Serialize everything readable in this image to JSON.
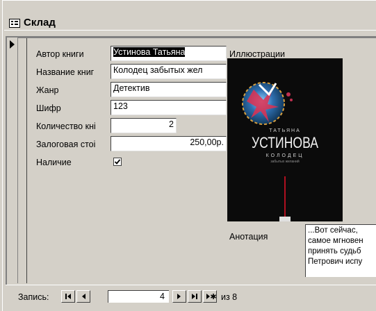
{
  "window": {
    "title": "Склад"
  },
  "fields": {
    "author": {
      "label": "Автор книги",
      "value": "Устинова Татьяна"
    },
    "title": {
      "label": "Название книг",
      "value": "Колодец забытых жел"
    },
    "genre": {
      "label": "Жанр",
      "value": "Детектив"
    },
    "code": {
      "label": "Шифр",
      "value": "123"
    },
    "quantity": {
      "label": "Количество кні",
      "value": "2"
    },
    "deposit": {
      "label": "Залоговая стоі",
      "value": "250,00р."
    },
    "availability": {
      "label": "Наличие",
      "checked": true
    }
  },
  "illustrations": {
    "label": "Иллюстрации"
  },
  "cover": {
    "author_small": "ТАТЬЯНА",
    "author": "УСТИНОВА",
    "title": "КОЛОДЕЦ",
    "subtitle": "забытых желаний"
  },
  "annotation": {
    "label": "Анотация",
    "lines": [
      "...Вот сейчас,",
      "самое мгновен",
      "принять судьб",
      "Петрович испу"
    ]
  },
  "navigation": {
    "record_label": "Запись:",
    "current_record": "4",
    "total_text": "из 8"
  },
  "colors": {
    "window_bg": "#d4d0c8",
    "field_bg": "#ffffff",
    "cover_bg": "#0b0b0b",
    "cover_accent": "#b01020"
  }
}
